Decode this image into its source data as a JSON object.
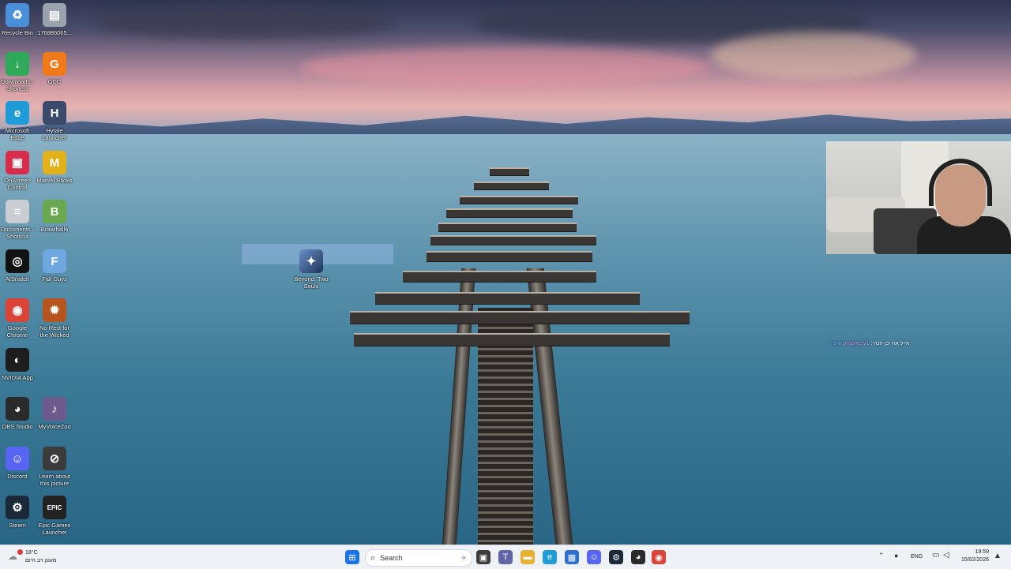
{
  "desktop": {
    "icons": [
      {
        "label": "Recycle Bin",
        "icon": "recycle-bin-icon",
        "color": "#4a90d9",
        "glyph": "♻"
      },
      {
        "label": "176886065...",
        "icon": "file-icon",
        "color": "#9aa3ad",
        "glyph": "▤"
      },
      {
        "label": "Downloads - Shortcut",
        "icon": "downloads-folder-icon",
        "color": "#2fa85a",
        "glyph": "↓"
      },
      {
        "label": "GCC",
        "icon": "gcc-icon",
        "color": "#f07a1a",
        "glyph": "G"
      },
      {
        "label": "Microsoft Edge",
        "icon": "edge-icon",
        "color": "#1f9bd8",
        "glyph": "e"
      },
      {
        "label": "Hytale Launcher",
        "icon": "hytale-icon",
        "color": "#3b4a6b",
        "glyph": "H"
      },
      {
        "label": "OnScreen Control",
        "icon": "onscreen-control-icon",
        "color": "#d92c4a",
        "glyph": "▣"
      },
      {
        "label": "Marvel Rivals",
        "icon": "marvel-rivals-icon",
        "color": "#e3b21b",
        "glyph": "M"
      },
      {
        "label": "Documents - Shortcut",
        "icon": "documents-folder-icon",
        "color": "#c9ccd1",
        "glyph": "≡"
      },
      {
        "label": "Brawlhalla",
        "icon": "brawlhalla-icon",
        "color": "#6aa84f",
        "glyph": "B"
      },
      {
        "label": "AISnatch",
        "icon": "aisnatch-icon",
        "color": "#111111",
        "glyph": "◎"
      },
      {
        "label": "Fall Guys",
        "icon": "fall-guys-icon",
        "color": "#6fa8e0",
        "glyph": "F"
      },
      {
        "label": "Google Chrome",
        "icon": "chrome-icon",
        "color": "#db4437",
        "glyph": "◉"
      },
      {
        "label": "No Rest for the Wicked",
        "icon": "no-rest-icon",
        "color": "#b5541c",
        "glyph": "✹"
      },
      {
        "label": "NVIDIA App",
        "icon": "nvidia-icon",
        "color": "#1d1d1d",
        "glyph": "◐"
      },
      {
        "label": "OBS Studio",
        "icon": "obs-icon",
        "color": "#2a2a2a",
        "glyph": "◕"
      },
      {
        "label": "MyVoiceZoo",
        "icon": "myvoicezoo-icon",
        "color": "#6c5a8c",
        "glyph": "♪"
      },
      {
        "label": "Discord",
        "icon": "discord-icon",
        "color": "#5865f2",
        "glyph": "☺"
      },
      {
        "label": "Learn about this picture",
        "icon": "learn-picture-icon",
        "color": "#3b3b3b",
        "glyph": "⊘"
      },
      {
        "label": "Steam",
        "icon": "steam-icon",
        "color": "#1b2838",
        "glyph": "⚙"
      },
      {
        "label": "Epic Games Launcher",
        "icon": "epic-games-icon",
        "color": "#222222",
        "glyph": "EPIC"
      }
    ],
    "dragged_icon": {
      "label": "Beyond: Two Souls",
      "icon": "beyond-two-souls-icon",
      "color": "#355a8f"
    }
  },
  "stream_overlay": {
    "chat_user": "prophecy1",
    "chat_message": ": אייל אה יבן זונה"
  },
  "taskbar": {
    "weather": {
      "temp": "18°C",
      "desc": "מעונן רב היום",
      "icon": "weather-cloud-icon"
    },
    "search_placeholder": "Search",
    "apps": [
      {
        "name": "start-button",
        "icon": "windows-icon",
        "color": "#1a73e8",
        "glyph": "⊞"
      },
      {
        "name": "task-view-button",
        "icon": "task-view-icon",
        "color": "#3c3c3c",
        "glyph": "▣"
      },
      {
        "name": "teams-button",
        "icon": "teams-icon",
        "color": "#6264a7",
        "glyph": "T"
      },
      {
        "name": "file-explorer-button",
        "icon": "folder-icon",
        "color": "#e8b230",
        "glyph": "▬"
      },
      {
        "name": "edge-taskbar-button",
        "icon": "edge-icon",
        "color": "#1f9bd8",
        "glyph": "e"
      },
      {
        "name": "store-button",
        "icon": "store-icon",
        "color": "#2c6fd1",
        "glyph": "▦"
      },
      {
        "name": "discord-taskbar-button",
        "icon": "discord-icon",
        "color": "#5865f2",
        "glyph": "☺"
      },
      {
        "name": "steam-taskbar-button",
        "icon": "steam-icon",
        "color": "#1b2838",
        "glyph": "⚙"
      },
      {
        "name": "obs-taskbar-button",
        "icon": "obs-icon",
        "color": "#2a2a2a",
        "glyph": "◕"
      },
      {
        "name": "chrome-taskbar-button",
        "icon": "chrome-icon",
        "color": "#db4437",
        "glyph": "◉"
      }
    ],
    "tray": {
      "language": "ENG",
      "time": "19:59",
      "date": "15/02/2026"
    }
  }
}
